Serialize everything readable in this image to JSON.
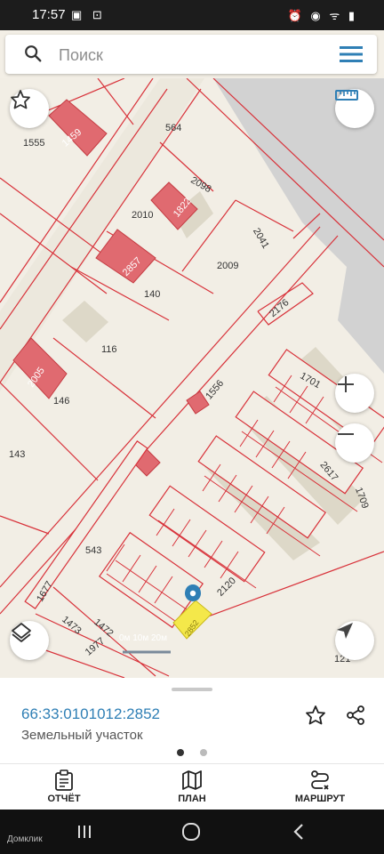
{
  "status": {
    "time": "17:57",
    "left_icons": "▣ ⊡",
    "right_icons": "⏰ ◉ ᯤ ▮"
  },
  "search": {
    "placeholder": "Поиск"
  },
  "map": {
    "labels": {
      "l1555": "1555",
      "l1459": "1459",
      "l564": "564",
      "l2098": "2098",
      "l2010": "2010",
      "l1822": "1822",
      "l2041": "2041",
      "l2857": "2857",
      "l2009": "2009",
      "l140": "140",
      "l2176": "2176",
      "l116": "116",
      "l2005": "2005",
      "l146": "146",
      "l1556": "1556",
      "l1701": "1701",
      "l143": "143",
      "l2617": "2617",
      "l1709": "1709",
      "l543": "543",
      "l2120": "2120",
      "l1677": "1677",
      "l1473": "1473",
      "l1472": "1472",
      "l1977": "1977",
      "l2852": "2852",
      "l121": "121"
    },
    "scale_label": "0м  10м  20м"
  },
  "parcel": {
    "cadastral_number": "66:33:0101012:2852",
    "type": "Земельный участок"
  },
  "pager": {
    "active_index": 0
  },
  "bottom_nav": {
    "report": "ОТЧЁТ",
    "plan": "ПЛАН",
    "route": "МАРШРУТ"
  },
  "system": {
    "brand": "Домклик"
  },
  "colors": {
    "accent": "#2f7fb5",
    "parcel_line": "#d8323a",
    "building_fill": "#e06a70",
    "highlight": "#f4e84a"
  }
}
